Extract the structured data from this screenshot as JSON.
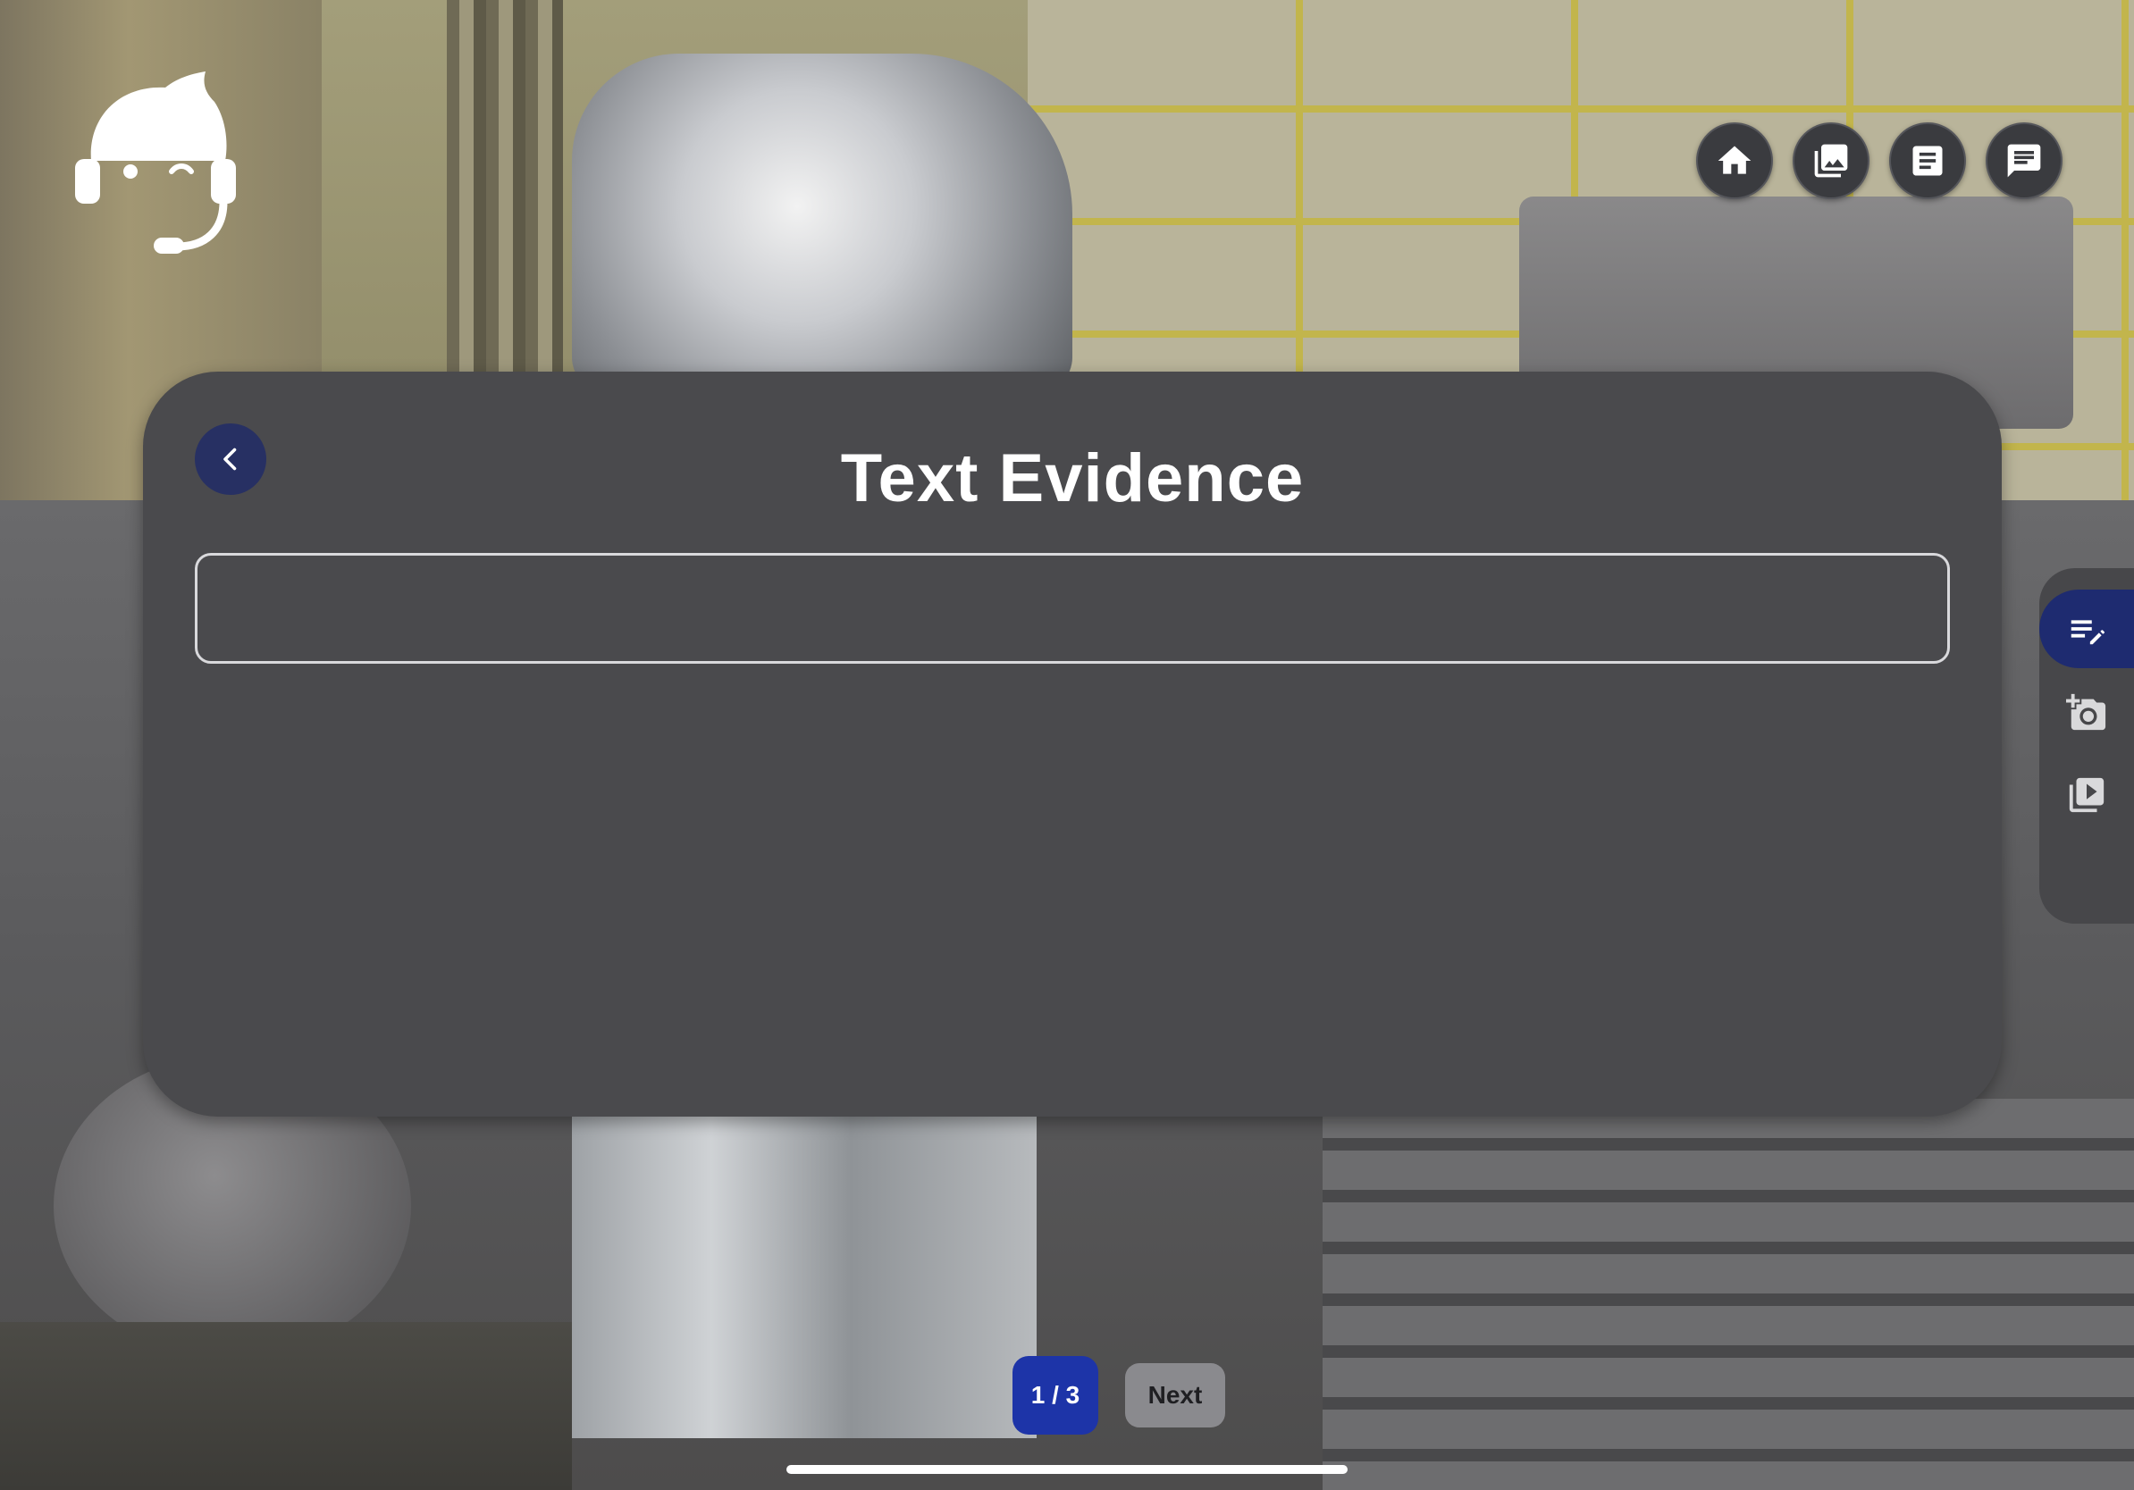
{
  "toolbar": {
    "buttons": [
      {
        "icon": "home-icon"
      },
      {
        "icon": "gallery-icon"
      },
      {
        "icon": "notes-icon"
      },
      {
        "icon": "chat-icon"
      }
    ]
  },
  "panel": {
    "title": "Text Evidence",
    "input_value": "",
    "input_placeholder": ""
  },
  "side_rail": {
    "items": [
      {
        "icon": "edit-text-icon",
        "active": true
      },
      {
        "icon": "add-photo-icon",
        "active": false
      },
      {
        "icon": "video-icon",
        "active": false
      }
    ]
  },
  "pager": {
    "current": "1 / 3",
    "next_label": "Next"
  },
  "colors": {
    "panel_bg": "#4a4a4d",
    "accent_navy": "#273063",
    "active_rail": "#1e2b70",
    "page_indicator": "#1d34a8",
    "next_button": "#8a8a8e"
  }
}
